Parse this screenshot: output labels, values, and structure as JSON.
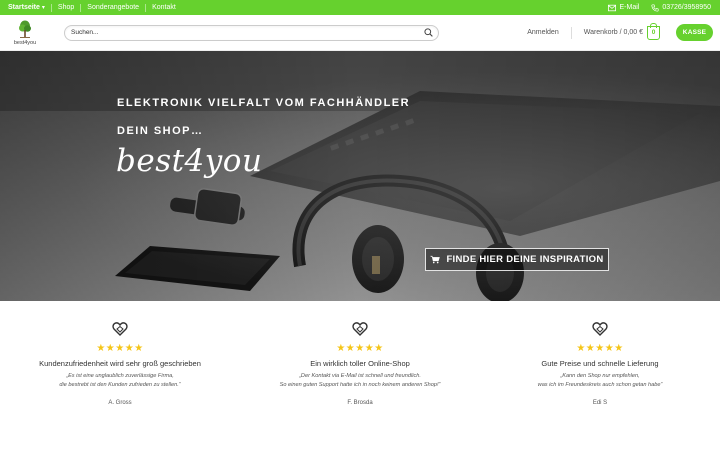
{
  "topbar": {
    "nav": [
      {
        "label": "Startseite",
        "has_dropdown": true
      },
      {
        "label": "Shop"
      },
      {
        "label": "Sonderangebote"
      },
      {
        "label": "Kontakt"
      }
    ],
    "email_label": "E-Mail",
    "phone": "03726/3958950",
    "color": "#66d12e"
  },
  "header": {
    "logo_text": "best4you",
    "search_placeholder": "Suchen...",
    "login_label": "Anmelden",
    "cart_label": "Warenkorb / 0,00 €",
    "cart_count": "0",
    "checkout_label": "KASSE"
  },
  "hero": {
    "line1": "ELEKTRONIK VIELFALT VOM FACHHÄNDLER",
    "line2": "DEIN SHOP…",
    "brand": "best4you",
    "cta_label": "FINDE HIER DEINE INSPIRATION"
  },
  "testimonials": [
    {
      "stars": "★★★★★",
      "title": "Kundenzufriedenheit wird sehr groß geschrieben",
      "quote_line1": "„Es ist eine unglaublich zuverlässige Firma,",
      "quote_line2": "die bestrebt ist den Kunden zufrieden zu stellen.“",
      "author": "A. Gross"
    },
    {
      "stars": "★★★★★",
      "title": "Ein wirklich toller Online-Shop",
      "quote_line1": "„Der Kontakt via E-Mail ist schnell und freundlich.",
      "quote_line2": "So einen guten Support hatte ich in noch keinem anderen Shop!“",
      "author": "F. Brosda"
    },
    {
      "stars": "★★★★★",
      "title": "Gute Preise und schnelle Lieferung",
      "quote_line1": "„Kann den Shop nur empfehlen,",
      "quote_line2": "was ich im Freundeskreis auch schon getan habe“",
      "author": "Edi S"
    }
  ]
}
